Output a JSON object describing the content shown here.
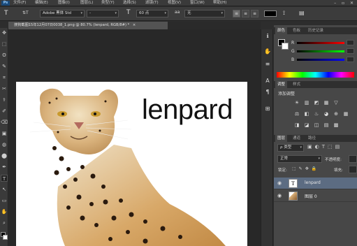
{
  "menubar": {
    "logo": "Ps",
    "items": [
      "文件(F)",
      "编辑(E)",
      "图像(I)",
      "图层(L)",
      "类型(Y)",
      "选择(S)",
      "滤镜(T)",
      "视图(V)",
      "窗口(W)",
      "帮助(H)"
    ],
    "window_controls": "– ▫ ✕"
  },
  "options": {
    "tool_icon": "T",
    "orient_icon": "⇅T",
    "font_family": "Adobe 黑体 Std",
    "font_style": "-",
    "size_icon": "T",
    "font_size": "60 点",
    "aa_icon": "aa",
    "antialias": "无",
    "color": "#000000"
  },
  "document": {
    "tab_title": "搜狗截图15年12月07日0038_1.png @ 80.7% (lenpard, RGB/8#) *",
    "close": "×"
  },
  "canvas": {
    "text": "lenpard"
  },
  "tools": [
    "✥",
    "⬚",
    "ʘ",
    "✎",
    "⌗",
    "✂",
    "⚕",
    "✐",
    "⌫",
    "▣",
    "◍",
    "⬤",
    "✒",
    "T",
    "↖",
    "▭",
    "✋",
    "⌕"
  ],
  "dock": [
    "ℹ",
    "✋",
    "≡",
    "A",
    "¶",
    "⊞"
  ],
  "color_panel": {
    "tabs": [
      "颜色",
      "色板",
      "历史记录"
    ],
    "sliders": [
      {
        "label": "R",
        "gradient_end": "#ff0000"
      },
      {
        "label": "G",
        "gradient_end": "#00ff00"
      },
      {
        "label": "B",
        "gradient_end": "#0000ff"
      }
    ]
  },
  "adjust_panel": {
    "tabs": [
      "调整",
      "样式"
    ],
    "title": "添加调整",
    "row1": [
      "☀",
      "▥",
      "◩",
      "▦",
      "▽"
    ],
    "row2": [
      "⚖",
      "◧",
      "♨",
      "◕",
      "⊕",
      "▦"
    ],
    "row3": [
      "◨",
      "◪",
      "◫",
      "▤",
      "▩"
    ]
  },
  "layers_panel": {
    "tabs": [
      "图层",
      "通道",
      "路径"
    ],
    "filter": "ρ 类型",
    "blend_mode": "正常",
    "opacity_label": "不透明度:",
    "lock_label": "锁定:",
    "fill_label": "填充:",
    "layers": [
      {
        "name": "lenpard",
        "thumb": "T",
        "selected": true
      },
      {
        "name": "图层 0",
        "thumb": "",
        "selected": false
      }
    ]
  }
}
